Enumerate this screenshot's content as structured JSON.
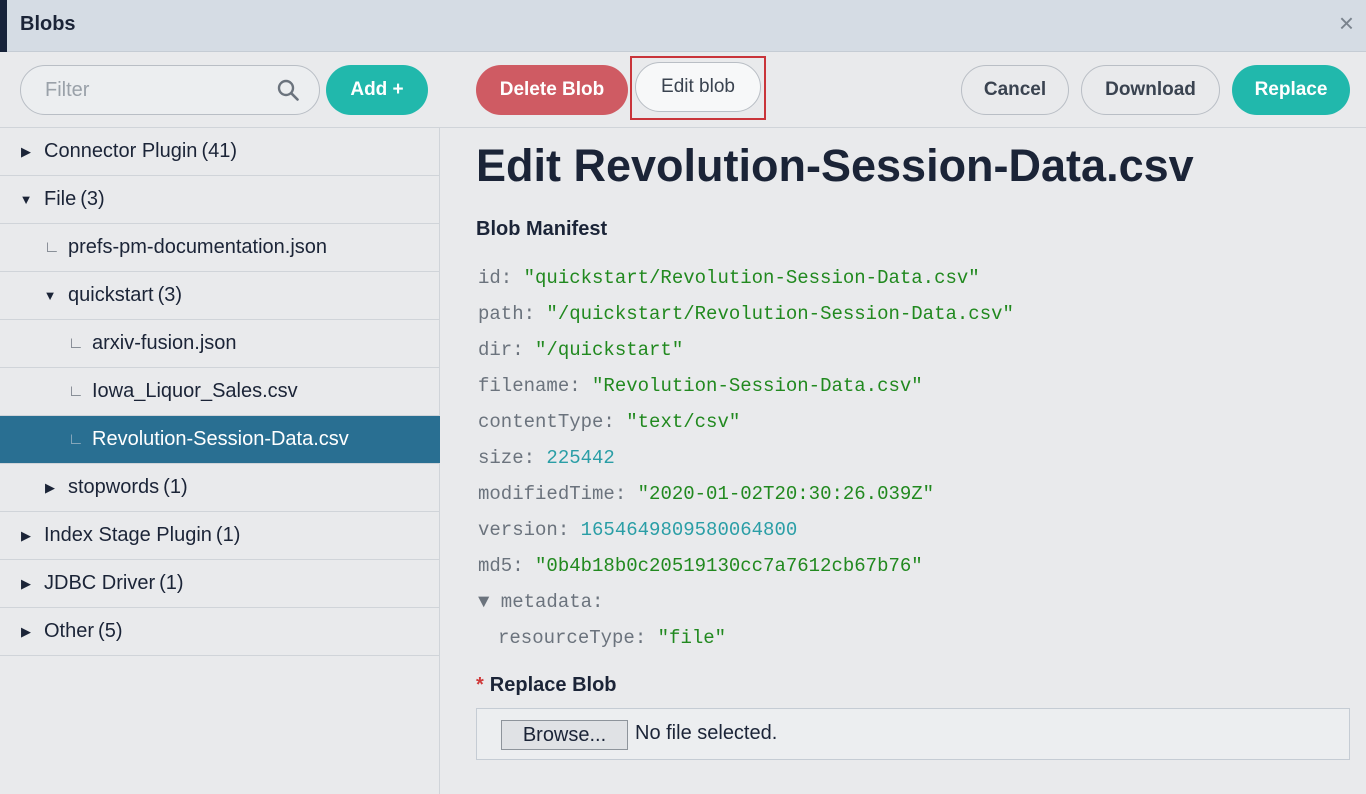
{
  "window": {
    "title": "Blobs",
    "close_glyph": "×"
  },
  "toolbar": {
    "filter_placeholder": "Filter",
    "add_label": "Add +",
    "delete_label": "Delete Blob",
    "edit_label": "Edit blob",
    "cancel_label": "Cancel",
    "download_label": "Download",
    "replace_label": "Replace"
  },
  "tree": [
    {
      "label": "Connector Plugin",
      "count": "(41)",
      "expanded": false,
      "level": 0
    },
    {
      "label": "File",
      "count": "(3)",
      "expanded": true,
      "level": 0
    },
    {
      "label": "prefs-pm-documentation.json",
      "leaf": true,
      "level": 1
    },
    {
      "label": "quickstart",
      "count": "(3)",
      "expanded": true,
      "level": 1
    },
    {
      "label": "arxiv-fusion.json",
      "leaf": true,
      "level": 2
    },
    {
      "label": "Iowa_Liquor_Sales.csv",
      "leaf": true,
      "level": 2
    },
    {
      "label": "Revolution-Session-Data.csv",
      "leaf": true,
      "level": 2,
      "selected": true
    },
    {
      "label": "stopwords",
      "count": "(1)",
      "expanded": false,
      "level": 1
    },
    {
      "label": "Index Stage Plugin",
      "count": "(1)",
      "expanded": false,
      "level": 0
    },
    {
      "label": "JDBC Driver",
      "count": "(1)",
      "expanded": false,
      "level": 0
    },
    {
      "label": "Other",
      "count": "(5)",
      "expanded": false,
      "level": 0
    }
  ],
  "main": {
    "title": "Edit Revolution-Session-Data.csv",
    "manifest_heading": "Blob Manifest",
    "manifest": {
      "id": "\"quickstart/Revolution-Session-Data.csv\"",
      "path": "\"/quickstart/Revolution-Session-Data.csv\"",
      "dir": "\"/quickstart\"",
      "filename": "\"Revolution-Session-Data.csv\"",
      "contentType": "\"text/csv\"",
      "size": "225442",
      "modifiedTime": "\"2020-01-02T20:30:26.039Z\"",
      "version": "1654649809580064800",
      "md5": "\"0b4b18b0c20519130cc7a7612cb67b76\"",
      "metadata_toggle": "▼",
      "resourceType": "\"file\""
    },
    "replace_heading": "Replace Blob",
    "required_marker": "*",
    "browse_label": "Browse...",
    "no_file_text": "No file selected."
  },
  "colors": {
    "accent_teal": "#21b8ac",
    "danger_red": "#cf5b63",
    "selected_row": "#296f92",
    "string_green": "#21891f",
    "number_teal": "#2a9ea6"
  },
  "icons": [
    "search-icon",
    "close-icon",
    "caret-right-icon",
    "caret-down-icon",
    "leaf-connector-icon"
  ]
}
